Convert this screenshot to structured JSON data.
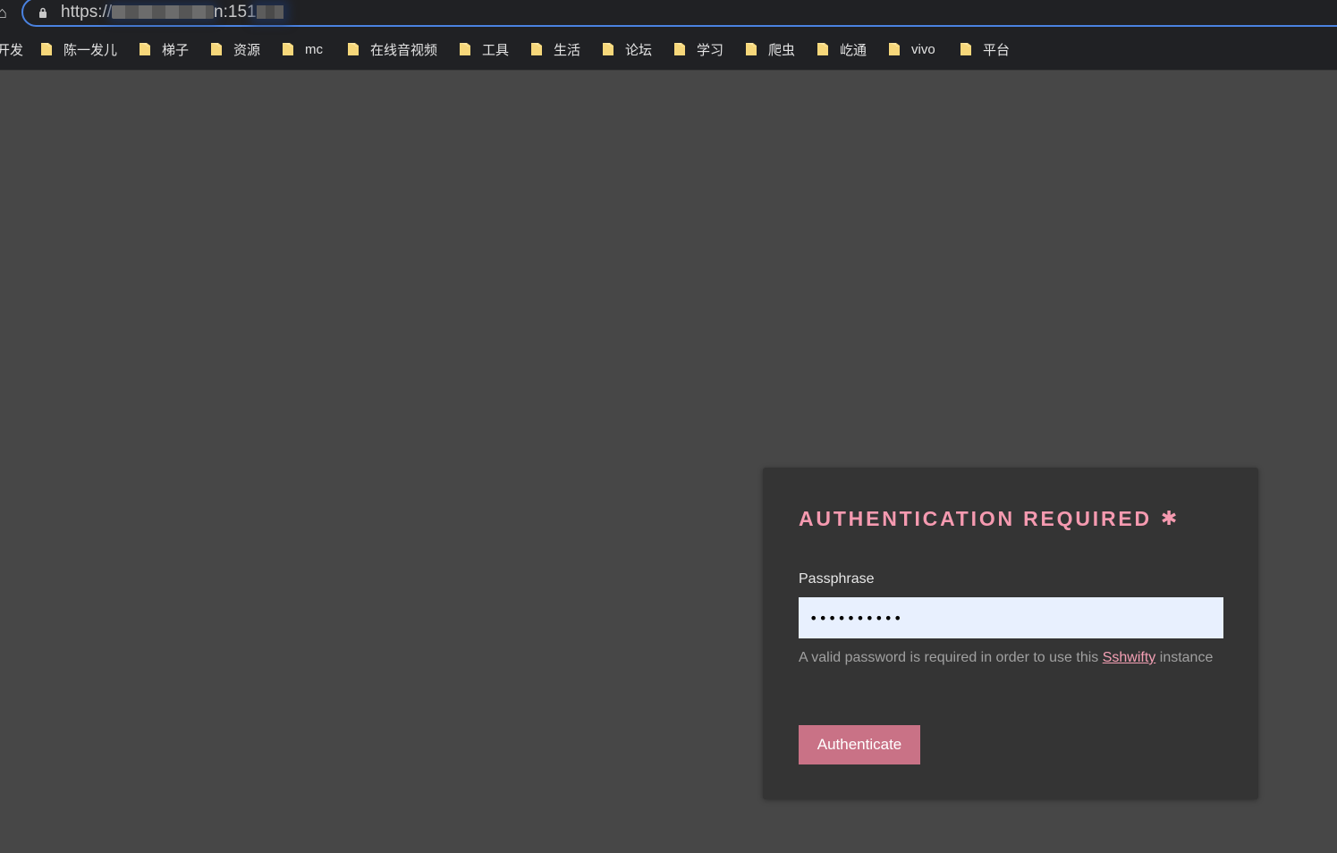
{
  "browser": {
    "url_prefix": "https://",
    "url_suffix": "n:151",
    "home_glyph": "⌂",
    "icons": [
      "home-icon",
      "lock-icon",
      "folder-icon"
    ],
    "bookmarks": [
      {
        "label": "开发",
        "has_icon": false
      },
      {
        "label": "陈一发儿",
        "has_icon": true
      },
      {
        "label": "梯子",
        "has_icon": true
      },
      {
        "label": "资源",
        "has_icon": true
      },
      {
        "label": "mc",
        "has_icon": true
      },
      {
        "label": "在线音视频",
        "has_icon": true
      },
      {
        "label": "工具",
        "has_icon": true
      },
      {
        "label": "生活",
        "has_icon": true
      },
      {
        "label": "论坛",
        "has_icon": true
      },
      {
        "label": "学习",
        "has_icon": true
      },
      {
        "label": "爬虫",
        "has_icon": true
      },
      {
        "label": "屹通",
        "has_icon": true
      },
      {
        "label": "vivo",
        "has_icon": true
      },
      {
        "label": "平台",
        "has_icon": true
      }
    ]
  },
  "auth": {
    "title": "AUTHENTICATION REQUIRED",
    "title_icon": "✱",
    "passphrase_label": "Passphrase",
    "passphrase_value": "••••••••••",
    "help_text_before": "A valid password is required in order to use this ",
    "help_link": "Sshwifty",
    "help_text_after": " instance",
    "button_label": "Authenticate"
  },
  "colors": {
    "page_background": "#474747",
    "card_background": "#343434",
    "accent": "#f59ab0",
    "button": "#c97286",
    "input_background": "#e8f0fe",
    "browser_chrome": "#202124",
    "focus_ring": "#4a82e0"
  }
}
